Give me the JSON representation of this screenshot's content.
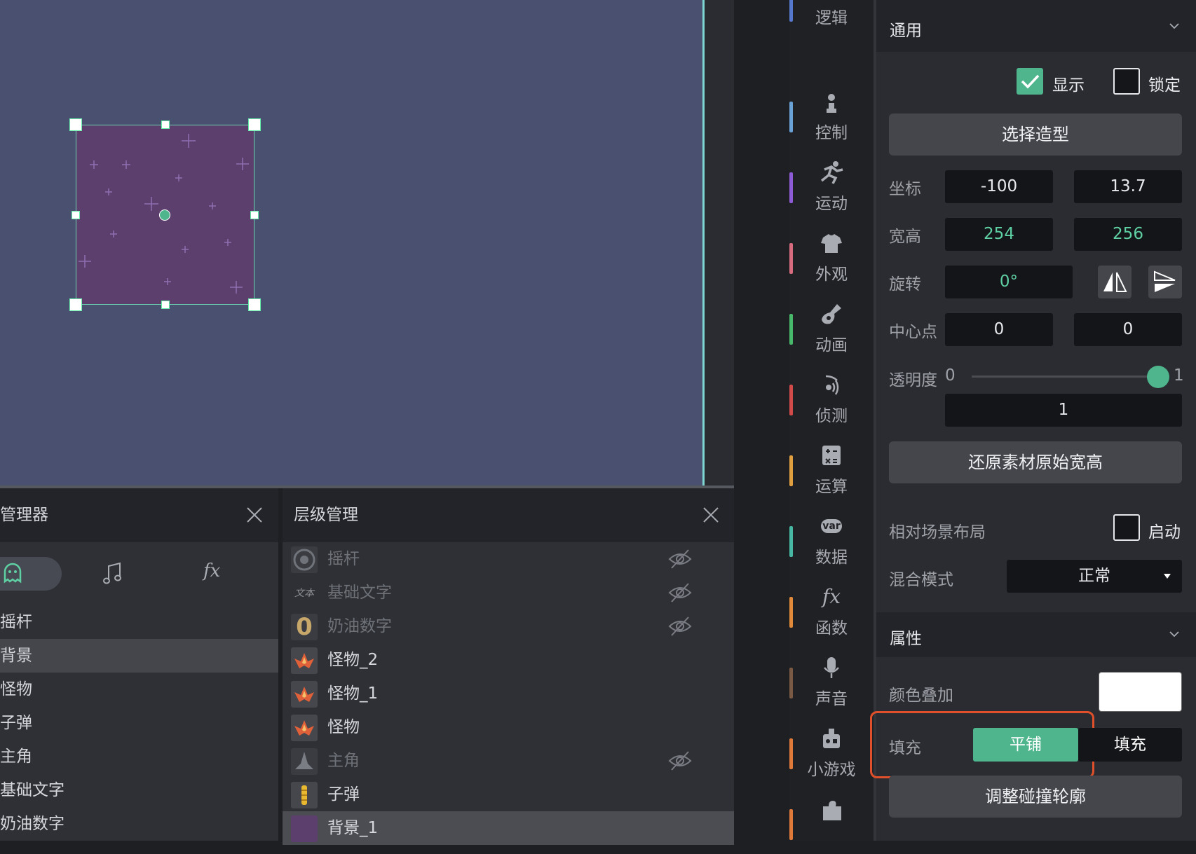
{
  "stage": {
    "colors": {
      "background": "#4a5170",
      "sprite": "#5c3f6d",
      "accent": "#5fd0a4"
    }
  },
  "asset_manager": {
    "title": "管理器",
    "tabs": [
      {
        "icon": "ghost-icon"
      },
      {
        "icon": "music-note-icon"
      },
      {
        "label": "fx",
        "icon": "function-icon"
      }
    ],
    "items": [
      "摇杆",
      "背景",
      "怪物",
      "子弹",
      "主角",
      "基础文字",
      "奶油数字"
    ],
    "selected_index": 1
  },
  "layer_manager": {
    "title": "层级管理",
    "rows": [
      {
        "name": "摇杆",
        "hidden": true,
        "thumb": "joystick"
      },
      {
        "name": "基础文字",
        "hidden": true,
        "thumb": "text",
        "thumb_text": "文本"
      },
      {
        "name": "奶油数字",
        "hidden": true,
        "thumb": "zero",
        "thumb_text": "0"
      },
      {
        "name": "怪物_2",
        "hidden": false,
        "thumb": "monster"
      },
      {
        "name": "怪物_1",
        "hidden": false,
        "thumb": "monster"
      },
      {
        "name": "怪物",
        "hidden": false,
        "thumb": "monster"
      },
      {
        "name": "主角",
        "hidden": true,
        "thumb": "ship"
      },
      {
        "name": "子弹",
        "hidden": false,
        "thumb": "bullet"
      },
      {
        "name": "背景_1",
        "hidden": false,
        "thumb": "bg",
        "selected": true
      }
    ]
  },
  "categories": [
    {
      "label": "逻辑",
      "color": "#5577cc",
      "icon": "logic-icon"
    },
    {
      "label": "控制",
      "color": "#6aa2d8",
      "icon": "joystick-icon"
    },
    {
      "label": "运动",
      "color": "#8d5bd6",
      "icon": "running-icon"
    },
    {
      "label": "外观",
      "color": "#d86b7e",
      "icon": "shirt-icon"
    },
    {
      "label": "动画",
      "color": "#48b86a",
      "icon": "guitar-icon"
    },
    {
      "label": "侦测",
      "color": "#d24a4a",
      "icon": "sensor-icon"
    },
    {
      "label": "运算",
      "color": "#e0a040",
      "icon": "calculator-icon"
    },
    {
      "label": "数据",
      "color": "#46b8a4",
      "icon": "var-icon",
      "icon_text": "var"
    },
    {
      "label": "函数",
      "color": "#e08a3a",
      "icon": "function-icon",
      "icon_text": "fx"
    },
    {
      "label": "声音",
      "color": "#7a5a44",
      "icon": "microphone-icon"
    },
    {
      "label": "小游戏",
      "color": "#e07a3a",
      "icon": "robot-icon"
    },
    {
      "label": "",
      "color": "#e07a3a",
      "icon": "puzzle-icon"
    }
  ],
  "props": {
    "general": {
      "title": "通用",
      "show_label": "显示",
      "show_checked": true,
      "lock_label": "锁定",
      "lock_checked": false,
      "select_shape": "选择造型",
      "position_label": "坐标",
      "x": "-100",
      "y": "13.7",
      "size_label": "宽高",
      "width": "254",
      "height": "256",
      "rotation_label": "旋转",
      "rotation": "0°",
      "pivot_label": "中心点",
      "pivot_x": "0",
      "pivot_y": "0",
      "opacity_label": "透明度",
      "opacity_min": "0",
      "opacity_max": "1",
      "opacity_value": "1",
      "opacity_fraction": 1.0,
      "restore_button": "还原素材原始宽高",
      "relative_layout_label": "相对场景布局",
      "relative_layout_toggle": "启动",
      "relative_layout_checked": false,
      "blend_label": "混合模式",
      "blend_value": "正常"
    },
    "attributes": {
      "title": "属性",
      "color_overlay_label": "颜色叠加",
      "color_overlay": "#ffffff",
      "fill_label": "填充",
      "fill_options": [
        "平铺",
        "填充"
      ],
      "fill_selected": "平铺",
      "collision_button": "调整碰撞轮廓"
    },
    "accent": "#4fb58d",
    "highlight": "#e0502a"
  }
}
